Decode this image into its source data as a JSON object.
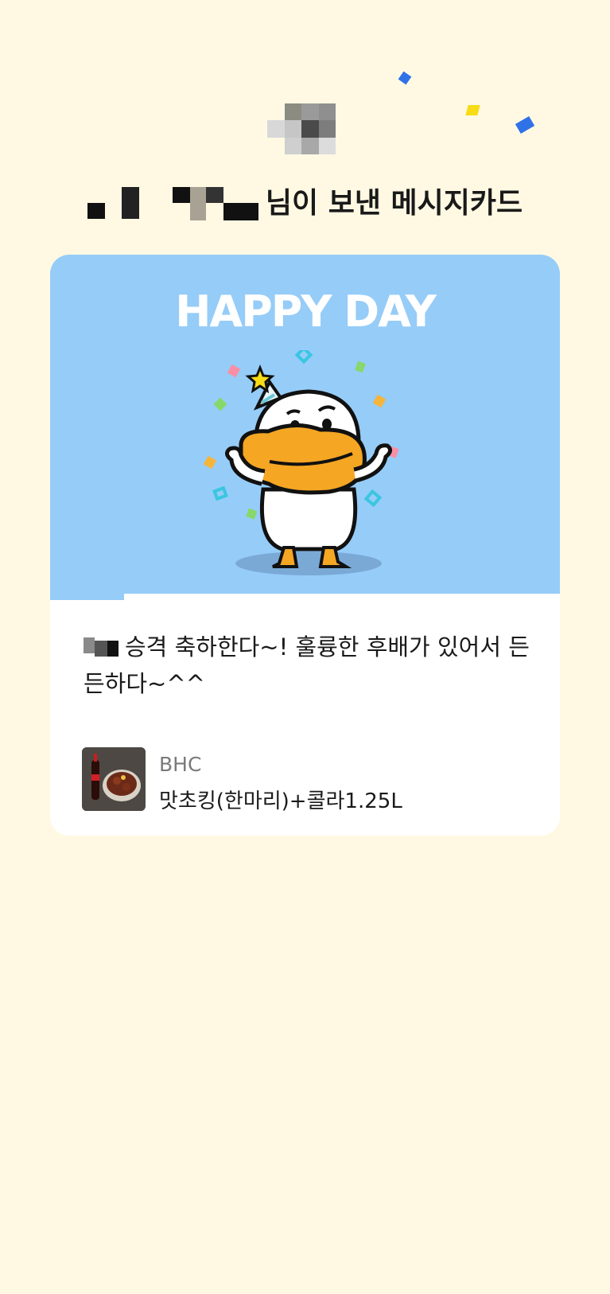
{
  "header": {
    "heading_suffix": "님이 보낸 메시지카드"
  },
  "card": {
    "image_title": "HAPPY DAY",
    "message": "승격 축하한다~! 훌륭한 후배가 있어서 든든하다~^^",
    "product": {
      "brand": "BHC",
      "name": "맛초킹(한마리)+콜라1.25L"
    }
  },
  "colors": {
    "background": "#fff9e3",
    "card_image_bg": "#96ccf8",
    "card_bg": "#ffffff",
    "confetti_blue": "#2f72e8",
    "confetti_yellow": "#f7dc16",
    "character_beak": "#f5a623"
  }
}
